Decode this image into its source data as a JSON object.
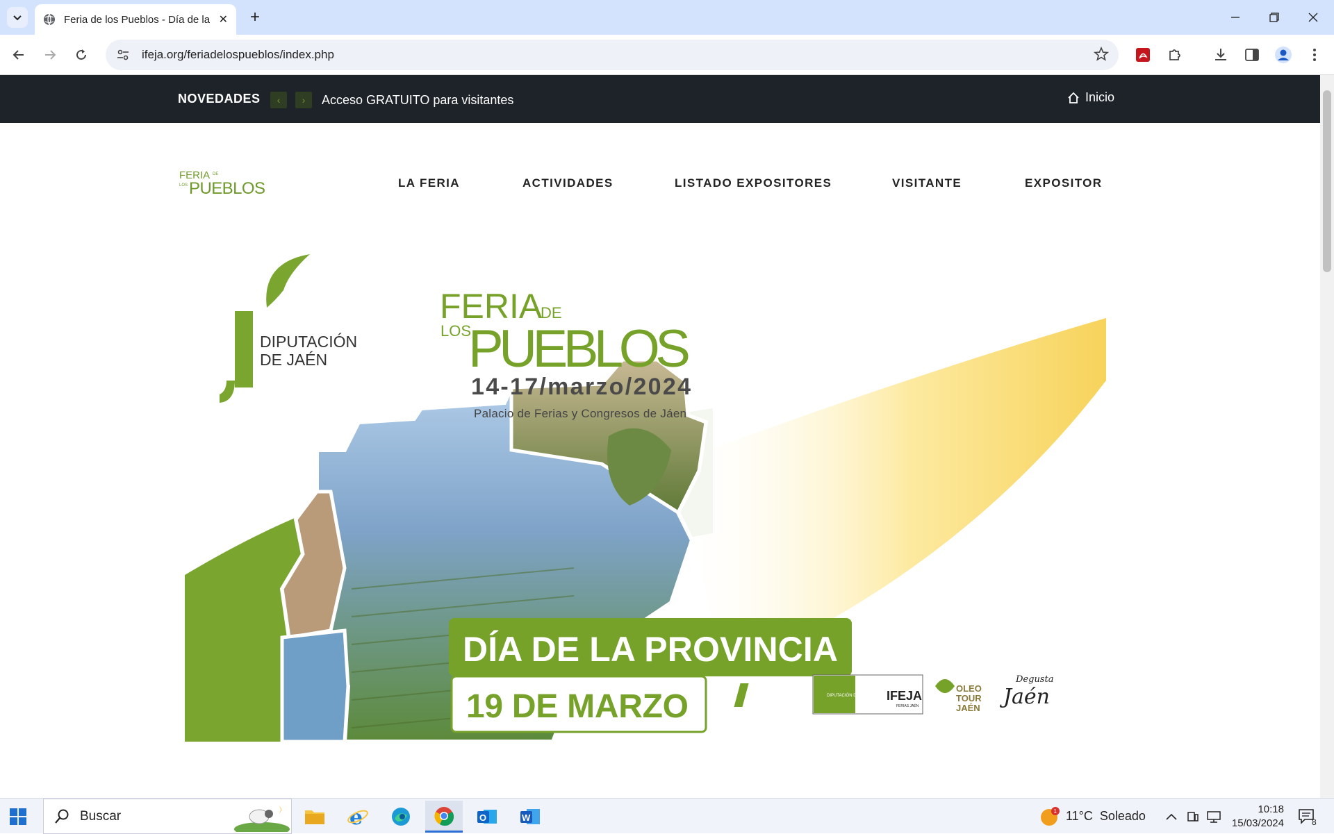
{
  "browser": {
    "tab_title": "Feria de los Pueblos - Día de la",
    "url": "ifeja.org/feriadelospueblos/index.php"
  },
  "topbar": {
    "novedades": "NOVEDADES",
    "ticker": "Acceso GRATUITO para visitantes",
    "inicio": "Inicio"
  },
  "logo": {
    "line1": "FERIA",
    "de": "DE",
    "los": "LOS",
    "line2": "PUEBLOS"
  },
  "menu": [
    {
      "label": "LA FERIA"
    },
    {
      "label": "ACTIVIDADES"
    },
    {
      "label": "LISTADO EXPOSITORES"
    },
    {
      "label": "VISITANTE"
    },
    {
      "label": "EXPOSITOR"
    }
  ],
  "banner": {
    "diputacion_1": "DIPUTACIÓN",
    "diputacion_2": "DE JAÉN",
    "feria": "FERIA",
    "de": "DE",
    "los": "LOS",
    "pueblos": "PUEBLOS",
    "dates": "14-17/marzo/2024",
    "venue": "Palacio de Ferias y Congresos de Jáen",
    "headline": "DÍA DE LA PROVINCIA",
    "date": "19 DE MARZO",
    "sponsor_ifeja": "IFEJA",
    "sponsor_ifeja_sub": "FERIAS JAÉN",
    "sponsor_dip": "DIPUTACIÓN DE JAÉN",
    "sponsor_oleo_1": "OLEO",
    "sponsor_oleo_2": "TOUR",
    "sponsor_oleo_3": "JAÉN",
    "sponsor_degusta": "Degusta",
    "sponsor_jaen": "Jaén"
  },
  "taskbar": {
    "search": "Buscar",
    "weather": "11°C  Soleado",
    "weather_badge": "1",
    "time": "10:18",
    "date": "15/03/2024",
    "notifications": "8"
  },
  "colors": {
    "brand_green": "#76a22a",
    "dark_bar": "#1d2328",
    "gold": "#f7d35b"
  }
}
